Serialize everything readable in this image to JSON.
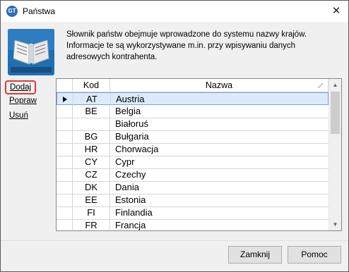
{
  "window": {
    "title": "Państwa",
    "close_glyph": "✕",
    "app_icon_text": "GT"
  },
  "description": "Słownik państw obejmuje wprowadzone do systemu nazwy krajów. Informacje te są wykorzystywane m.in. przy wpisywaniu danych adresowych kontrahenta.",
  "actions": {
    "add": "Dodaj",
    "edit": "Popraw",
    "delete": "Usuń"
  },
  "grid": {
    "columns": {
      "code": "Kod",
      "name": "Nazwa"
    },
    "rows": [
      {
        "code": "AT",
        "name": "Austria",
        "selected": true
      },
      {
        "code": "BE",
        "name": "Belgia"
      },
      {
        "code": "",
        "name": "Białoruś"
      },
      {
        "code": "BG",
        "name": "Bułgaria"
      },
      {
        "code": "HR",
        "name": "Chorwacja"
      },
      {
        "code": "CY",
        "name": "Cypr"
      },
      {
        "code": "CZ",
        "name": "Czechy"
      },
      {
        "code": "DK",
        "name": "Dania"
      },
      {
        "code": "EE",
        "name": "Estonia"
      },
      {
        "code": "FI",
        "name": "Finlandia"
      },
      {
        "code": "FR",
        "name": "Francja"
      }
    ]
  },
  "buttons": {
    "close": "Zamknij",
    "help": "Pomoc"
  },
  "colors": {
    "selected_row": "#dcebfc",
    "highlight_border": "#e0383e",
    "book_bg": "#1e6fb3"
  }
}
